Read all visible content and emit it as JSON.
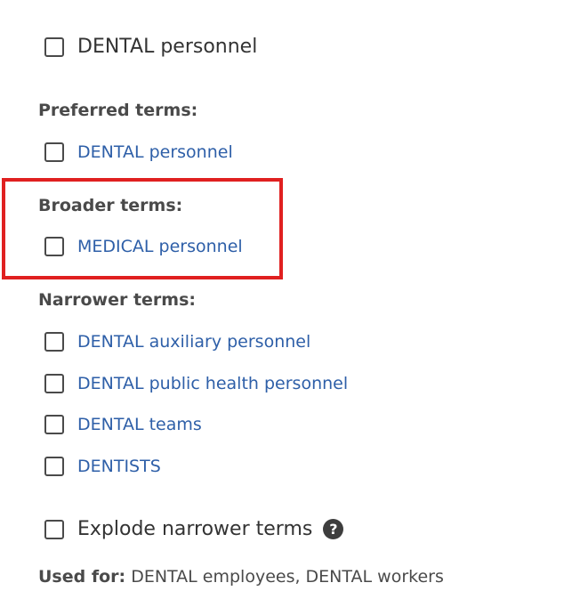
{
  "main_term": {
    "label": "DENTAL personnel"
  },
  "preferred": {
    "heading": "Preferred terms:",
    "items": [
      {
        "label": "DENTAL personnel"
      }
    ]
  },
  "broader": {
    "heading": "Broader terms:",
    "items": [
      {
        "label": "MEDICAL personnel"
      }
    ],
    "highlight_color": "#e02020"
  },
  "narrower": {
    "heading": "Narrower terms:",
    "items": [
      {
        "label": "DENTAL auxiliary personnel"
      },
      {
        "label": "DENTAL public health personnel"
      },
      {
        "label": "DENTAL teams"
      },
      {
        "label": "DENTISTS"
      }
    ]
  },
  "explode": {
    "label": "Explode narrower terms",
    "help_glyph": "?"
  },
  "used_for": {
    "label": "Used for:",
    "value": "DENTAL employees, DENTAL workers"
  },
  "colors": {
    "link": "#2e5fa8",
    "text": "#333333",
    "heading": "#4a4a4a"
  }
}
